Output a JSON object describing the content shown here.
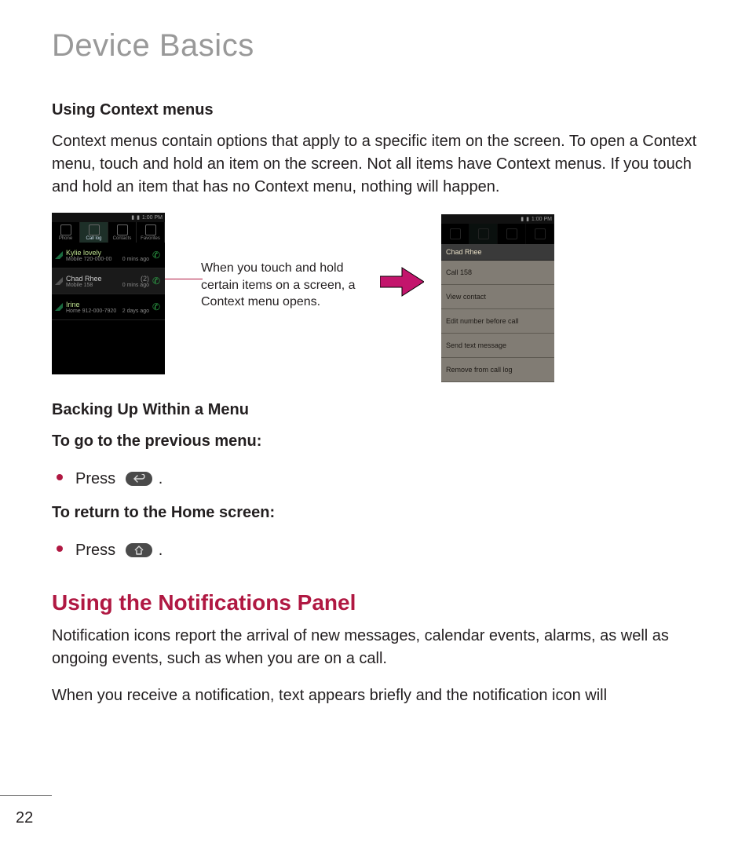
{
  "page_number": "22",
  "section_title": "Device Basics",
  "context": {
    "heading": "Using Context menus",
    "paragraph": "Context menus contain options that apply to a specific item on the screen. To open a Context menu, touch and hold an item on the screen. Not all items have Context menus. If you touch and hold an item that has no Context menu, nothing will happen."
  },
  "callout_text": "When you touch and hold certain items on a screen, a Context menu opens.",
  "phone_left": {
    "time": "1:00 PM",
    "tabs": [
      "Phone",
      "Call log",
      "Contacts",
      "Favorites"
    ],
    "selected_tab": 1,
    "log": [
      {
        "name": "Kylie lovely",
        "sub_left": "Mobile 720-000-00",
        "sub_right": "0 mins ago"
      },
      {
        "name": "Chad Rhee",
        "sub_left": "Mobile 158",
        "sub_right": "0 mins ago",
        "badge": "(2)"
      },
      {
        "name": "Irine",
        "sub_left": "Home 912-000-7920",
        "sub_right": "2 days ago"
      }
    ]
  },
  "phone_right": {
    "time": "1:00 PM",
    "header": "Chad Rhee",
    "items": [
      "Call 158",
      "View contact",
      "Edit number before call",
      "Send text message",
      "Remove from call log"
    ]
  },
  "backing": {
    "heading": "Backing Up Within a Menu",
    "prev_label": "To go to the previous menu:",
    "press_word": "Press",
    "home_label": "To return to the Home screen:"
  },
  "notifications": {
    "heading": "Using the Notifications Panel",
    "p1": "Notification icons report the arrival of new messages, calendar events, alarms, as well as ongoing events, such as when you are on a call.",
    "p2": "When you receive a notification, text appears briefly and the notification icon will"
  },
  "icons": {
    "back": "back-key-icon",
    "home": "home-key-icon"
  }
}
